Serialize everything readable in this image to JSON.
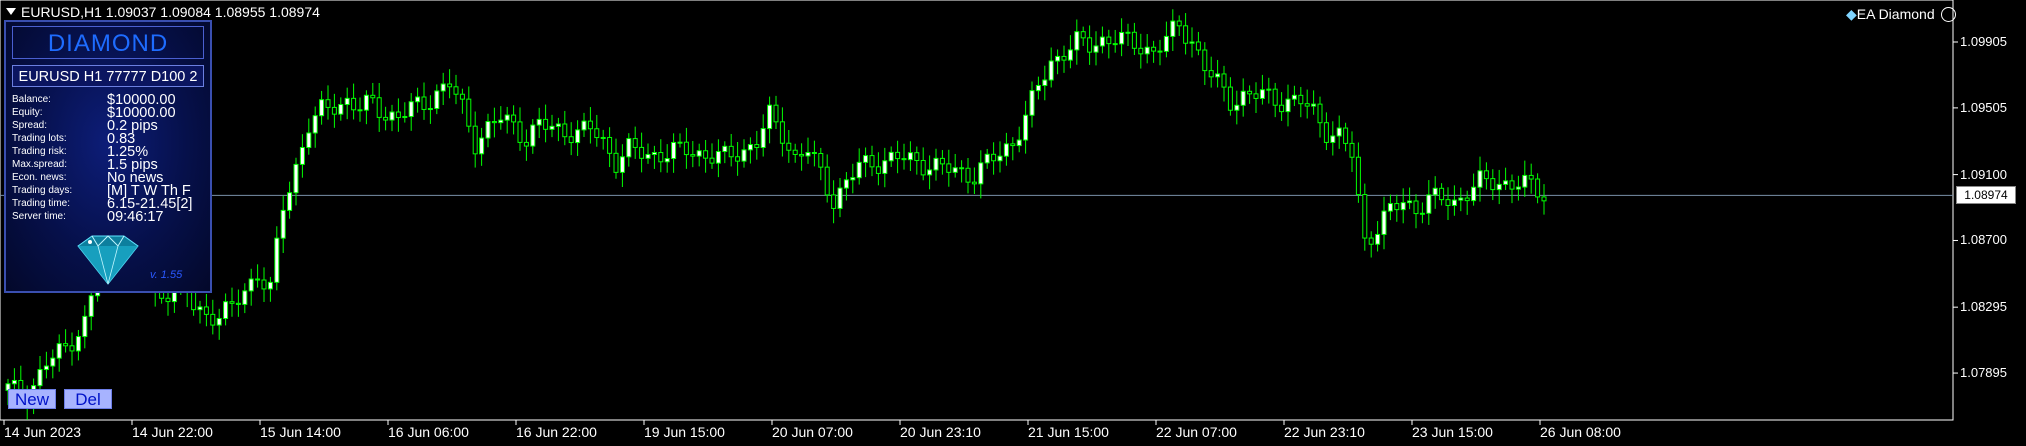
{
  "window": {
    "symbol_line": "EURUSD,H1  1.09037 1.09084 1.08955 1.08974",
    "ea_name": "EA Diamond"
  },
  "colors": {
    "background": "#000000",
    "candle": "#00ff00",
    "bull_body": "#ffffff",
    "bid_line": "#7a90a8",
    "panel_bg": "#07125a",
    "panel_title": "#1e6cff"
  },
  "chart_data": {
    "type": "candlestick",
    "title": "",
    "ylim": [
      1.0761,
      1.1016
    ],
    "y_ticks": [
      "1.09905",
      "1.09505",
      "1.09100",
      "1.08700",
      "1.08295",
      "1.07895"
    ],
    "y_tick_values": [
      1.09905,
      1.09505,
      1.091,
      1.087,
      1.08295,
      1.07895
    ],
    "current_price": "1.08974",
    "current_price_value": 1.08974,
    "x_labels": [
      "14 Jun 2023",
      "14 Jun 22:00",
      "15 Jun 14:00",
      "16 Jun 06:00",
      "16 Jun 22:00",
      "19 Jun 15:00",
      "20 Jun 07:00",
      "20 Jun 23:10",
      "21 Jun 15:00",
      "22 Jun 07:00",
      "22 Jun 23:10",
      "23 Jun 15:00",
      "26 Jun 08:00"
    ],
    "anchors": [
      [
        0,
        1.078
      ],
      [
        3,
        1.0776
      ],
      [
        6,
        1.0795
      ],
      [
        9,
        1.0805
      ],
      [
        12,
        1.082
      ],
      [
        14,
        1.085
      ],
      [
        17,
        1.087
      ],
      [
        19,
        1.0885
      ],
      [
        21,
        1.0865
      ],
      [
        23,
        1.0835
      ],
      [
        25,
        1.084
      ],
      [
        27,
        1.0845
      ],
      [
        29,
        1.083
      ],
      [
        31,
        1.0825
      ],
      [
        33,
        1.0825
      ],
      [
        35,
        1.0828
      ],
      [
        37,
        1.084
      ],
      [
        39,
        1.085
      ],
      [
        41,
        1.084
      ],
      [
        43,
        1.089
      ],
      [
        45,
        1.0915
      ],
      [
        47,
        1.094
      ],
      [
        49,
        1.0948
      ],
      [
        51,
        1.0952
      ],
      [
        53,
        1.0955
      ],
      [
        55,
        1.095
      ],
      [
        57,
        1.0953
      ],
      [
        59,
        1.0947
      ],
      [
        61,
        1.0945
      ],
      [
        63,
        1.095
      ],
      [
        65,
        1.0953
      ],
      [
        67,
        1.096
      ],
      [
        69,
        1.0965
      ],
      [
        71,
        1.095
      ],
      [
        73,
        1.093
      ],
      [
        75,
        1.0938
      ],
      [
        77,
        1.0944
      ],
      [
        79,
        1.094
      ],
      [
        81,
        1.0932
      ],
      [
        83,
        1.094
      ],
      [
        85,
        1.0938
      ],
      [
        87,
        1.0937
      ],
      [
        89,
        1.0935
      ],
      [
        91,
        1.0938
      ],
      [
        93,
        1.093
      ],
      [
        95,
        1.0918
      ],
      [
        97,
        1.0925
      ],
      [
        100,
        1.0922
      ],
      [
        103,
        1.0923
      ],
      [
        106,
        1.0925
      ],
      [
        109,
        1.0922
      ],
      [
        112,
        1.092
      ],
      [
        115,
        1.0925
      ],
      [
        117,
        1.093
      ],
      [
        119,
        1.0945
      ],
      [
        121,
        1.0935
      ],
      [
        123,
        1.092
      ],
      [
        125,
        1.0925
      ],
      [
        127,
        1.091
      ],
      [
        129,
        1.0895
      ],
      [
        131,
        1.0905
      ],
      [
        133,
        1.0915
      ],
      [
        136,
        1.0918
      ],
      [
        139,
        1.092
      ],
      [
        142,
        1.0918
      ],
      [
        145,
        1.0915
      ],
      [
        148,
        1.0912
      ],
      [
        151,
        1.091
      ],
      [
        153,
        1.0917
      ],
      [
        155,
        1.0922
      ],
      [
        157,
        1.093
      ],
      [
        159,
        1.0945
      ],
      [
        161,
        1.0963
      ],
      [
        163,
        1.0978
      ],
      [
        165,
        1.0985
      ],
      [
        167,
        1.099
      ],
      [
        169,
        1.0988
      ],
      [
        171,
        1.0992
      ],
      [
        173,
        1.0993
      ],
      [
        175,
        1.099
      ],
      [
        177,
        1.0988
      ],
      [
        179,
        1.0985
      ],
      [
        181,
        1.0992
      ],
      [
        183,
        1.1
      ],
      [
        185,
        1.0992
      ],
      [
        187,
        1.0975
      ],
      [
        189,
        1.0965
      ],
      [
        191,
        1.0955
      ],
      [
        193,
        1.0958
      ],
      [
        196,
        1.0958
      ],
      [
        199,
        1.0955
      ],
      [
        202,
        1.0954
      ],
      [
        204,
        1.0948
      ],
      [
        206,
        1.0937
      ],
      [
        208,
        1.0933
      ],
      [
        210,
        1.0922
      ],
      [
        211,
        1.0895
      ],
      [
        212,
        1.087
      ],
      [
        214,
        1.0878
      ],
      [
        216,
        1.0888
      ],
      [
        218,
        1.0893
      ],
      [
        220,
        1.089
      ],
      [
        222,
        1.0895
      ],
      [
        224,
        1.0895
      ],
      [
        226,
        1.0893
      ],
      [
        228,
        1.09
      ],
      [
        230,
        1.0905
      ],
      [
        233,
        1.0905
      ],
      [
        236,
        1.0905
      ],
      [
        238,
        1.0902
      ],
      [
        240,
        1.0898
      ]
    ],
    "bid_line": true
  },
  "panel": {
    "title": "DIAMOND",
    "subtitle": "EURUSD H1 77777  D100 2",
    "stats": [
      {
        "label": "Balance:",
        "value": "$10000.00"
      },
      {
        "label": "Equity:",
        "value": "$10000.00"
      },
      {
        "label": "Spread:",
        "value": "0.2 pips"
      },
      {
        "label": "Trading lots:",
        "value": "0.83"
      },
      {
        "label": "Trading risk:",
        "value": "1.25%"
      },
      {
        "label": "Max.spread:",
        "value": "1.5 pips"
      },
      {
        "label": "Econ. news:",
        "value": "No news"
      },
      {
        "label": "Trading days:",
        "value": "[M] T W Th F"
      },
      {
        "label": "Trading time:",
        "value": "6.15-21.45[2]"
      },
      {
        "label": "Server time:",
        "value": "09:46:17"
      }
    ],
    "version": "v. 1.55"
  },
  "buttons": {
    "new": "New",
    "del": "Del"
  }
}
